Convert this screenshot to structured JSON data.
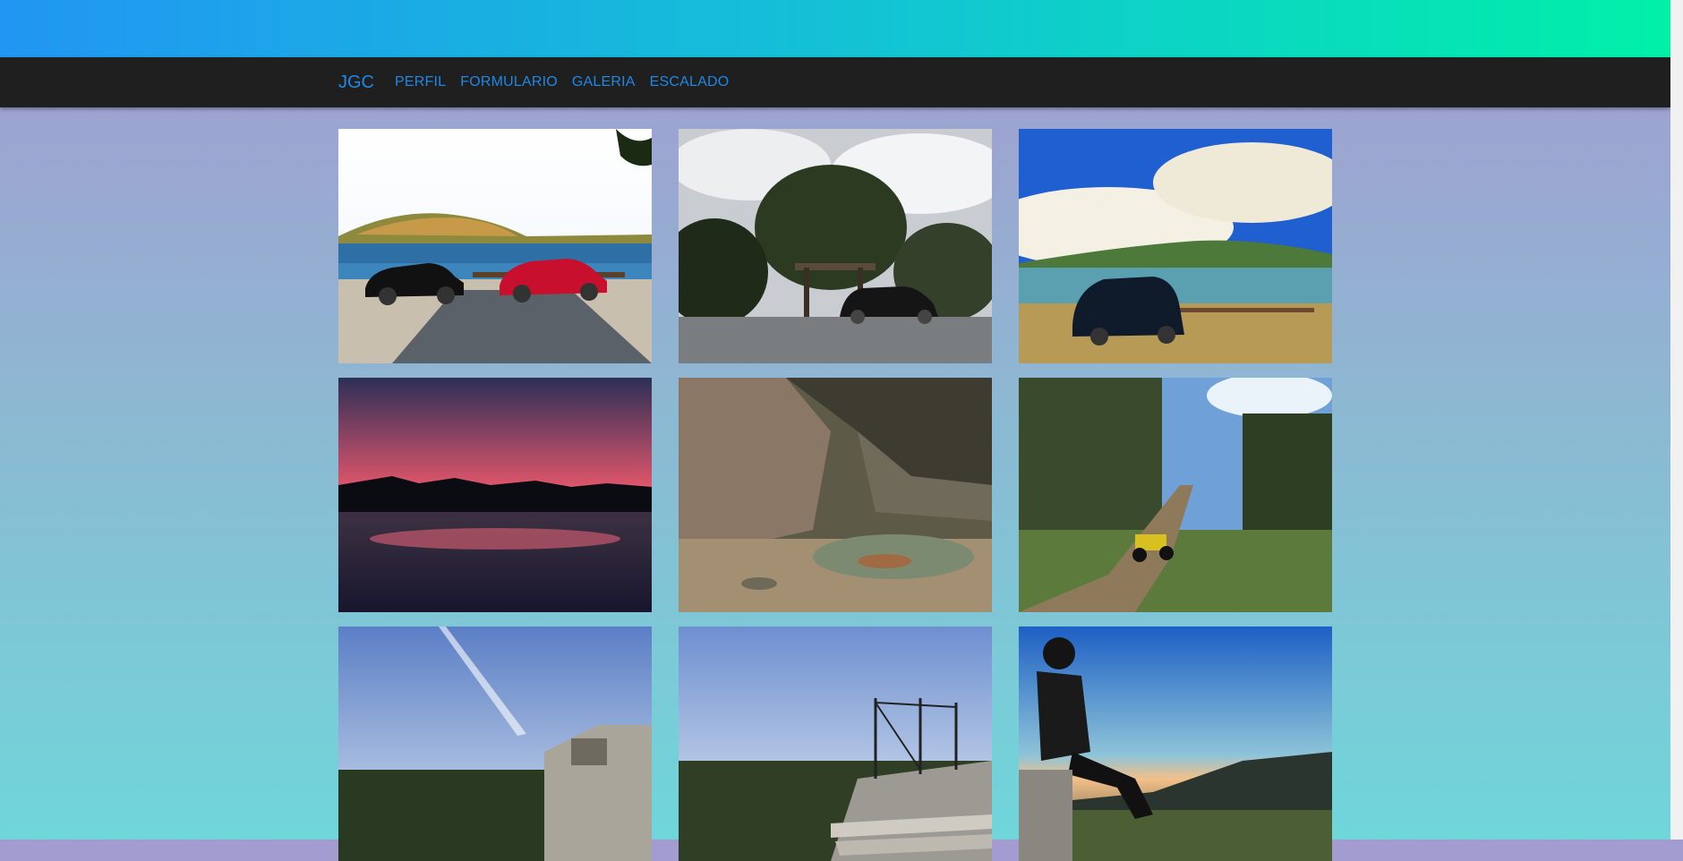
{
  "navbar": {
    "brand": "JGC",
    "links": [
      "PERFIL",
      "FORMULARIO",
      "GALERIA",
      "ESCALADO"
    ]
  },
  "colors": {
    "nav_background": "#1f1f1f",
    "link": "#1e88e5",
    "banner_gradient": [
      "#2196f3",
      "#00f0a8"
    ],
    "page_gradient": [
      "#a39bd0",
      "#6fd6da"
    ]
  },
  "gallery": {
    "photos": [
      {
        "icon": "photo-cars-lake"
      },
      {
        "icon": "photo-car-tree"
      },
      {
        "icon": "photo-car-coast"
      },
      {
        "icon": "photo-sunset-lake"
      },
      {
        "icon": "photo-rocks-stream"
      },
      {
        "icon": "photo-quad-forest"
      },
      {
        "icon": "photo-sky-concrete"
      },
      {
        "icon": "photo-railing-steps"
      },
      {
        "icon": "photo-person-sunset"
      }
    ]
  }
}
